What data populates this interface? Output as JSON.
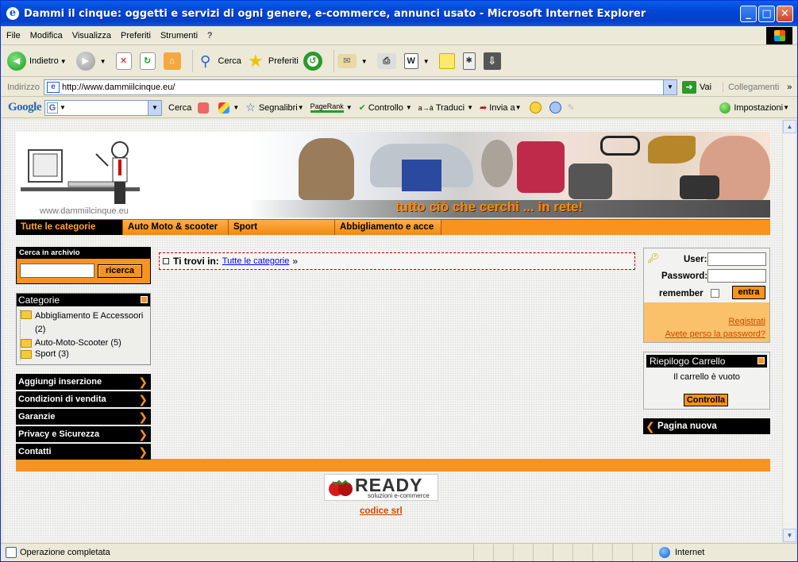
{
  "window": {
    "title": "Dammi il cinque: oggetti e servizi di ogni genere, e-commerce, annunci usato - Microsoft Internet Explorer",
    "controls": {
      "minimize": "_",
      "maximize": "□",
      "close": "✕"
    }
  },
  "menu": [
    "File",
    "Modifica",
    "Visualizza",
    "Preferiti",
    "Strumenti",
    "?"
  ],
  "toolbar": {
    "back_label": "Indietro",
    "search_label": "Cerca",
    "favorites_label": "Preferiti"
  },
  "address": {
    "label": "Indirizzo",
    "url": "http://www.dammiilcinque.eu/",
    "go_label": "Vai",
    "links_label": "Collegamenti",
    "chevron": "»"
  },
  "google_bar": {
    "logo": "Google",
    "search_label": "Cerca",
    "bookmarks_label": "Segnalibri",
    "pagerank_label": "PageRank",
    "check_label": "Controllo",
    "translate_label": "Traduci",
    "send_label": "Invia a",
    "settings_label": "Impostazioni"
  },
  "site": {
    "domain_text": "www.dammiilcinque.eu",
    "slogan": "tutto ciò che cerchi ... in rete!",
    "nav_tabs": [
      {
        "label": "Tutte le categorie",
        "active": true
      },
      {
        "label": "Auto Moto & scooter",
        "active": false
      },
      {
        "label": "Sport",
        "active": false
      },
      {
        "label": "Abbigliamento e acce",
        "active": false
      }
    ],
    "search_box": {
      "title": "Cerca in archivio",
      "input_value": "",
      "button_label": "ricerca"
    },
    "categories": {
      "title": "Categorie",
      "items": [
        {
          "name": "Abbigliamento E Accessoori",
          "count": "(2)"
        },
        {
          "name": "Auto-Moto-Scooter",
          "count": "(5)"
        },
        {
          "name": "Sport",
          "count": "(3)"
        }
      ]
    },
    "side_links": [
      "Aggiungi inserzione",
      "Condizioni di vendita",
      "Garanzie",
      "Privacy e Sicurezza",
      "Contatti"
    ],
    "breadcrumb": {
      "prefix": "Ti trovi in:",
      "link": "Tutte le categorie",
      "suffix": "»"
    },
    "login": {
      "user_label": "User:",
      "password_label": "Password:",
      "remember_label": "remember",
      "submit_label": "entra",
      "register_link": "Registrati",
      "forgot_link": "Avete perso la password?"
    },
    "cart": {
      "title": "Riepilogo Carrello",
      "empty_text": "Il carrello è vuoto",
      "button_label": "Controlla"
    },
    "new_page_label": "Pagina nuova",
    "footer": {
      "logo_text": "READY",
      "logo_sub": "soluzioni e-commerce",
      "credit_link": "codice srl"
    }
  },
  "status": {
    "text": "Operazione completata",
    "zone": "Internet"
  },
  "colors": {
    "accent_orange": "#f7931e",
    "title_blue": "#0046d5",
    "link_blue": "#0000ff"
  }
}
